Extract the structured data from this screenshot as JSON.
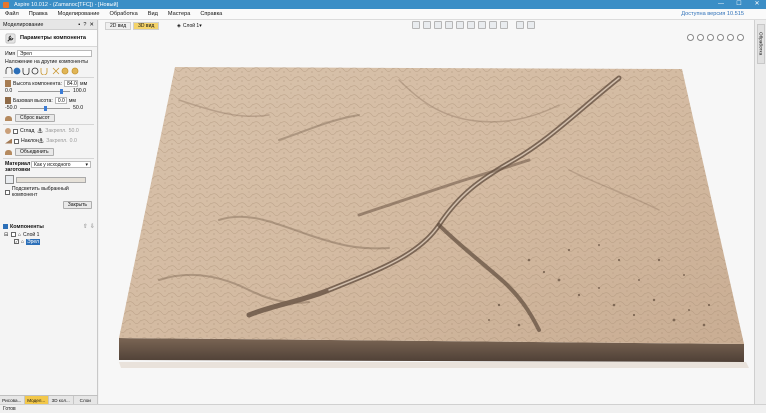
{
  "titlebar": {
    "title": "Aspire 10.012 - (Zamanoc[TFC]) - [Новый]",
    "min": "—",
    "max": "☐",
    "close": "✕"
  },
  "menu": {
    "items": [
      "Файл",
      "Правка",
      "Моделирование",
      "Обработка",
      "Вид",
      "Мастера",
      "Справка"
    ],
    "version_link": "Доступна версия 10.515"
  },
  "left_panel": {
    "header": "Моделирование",
    "params_title": "Параметры компонента",
    "name_label": "Имя",
    "name_value": "Эрел",
    "overlay_label": "Наложение на другие компоненты",
    "height_label": "Высота компонента:",
    "height_value": "84.0",
    "height_unit": "мм",
    "height_min": "0.0",
    "height_max": "100.0",
    "height_fraction": 0.84,
    "base_label": "Базовая высота:",
    "base_value": "0.0",
    "base_unit": "мм",
    "base_min": "-50.0",
    "base_max": "50.0",
    "base_fraction": 0.5,
    "reset_height": "Сброс высот",
    "smooth_label": "Сглад",
    "fix_label": "Закрепл.",
    "smooth_value": "50.0",
    "tilt_label": "Наклон",
    "tilt_value": "0.0",
    "combine_button": "Объединить",
    "material_label": "Материал заготовки",
    "material_select": "Как у исходного",
    "highlight_label": "Подсветить выбранный компонент",
    "close_button": "Закрыть"
  },
  "components": {
    "title": "Компоненты",
    "layer": "Слой 1",
    "item": "Эрел"
  },
  "bottom_tabs": [
    "Рисова...",
    "Модел...",
    "3D кол...",
    "Слои"
  ],
  "status": "Готов",
  "view": {
    "tabs": [
      "2D вид",
      "3D вид"
    ],
    "layer_select": "Слой 1"
  },
  "right_strip": {
    "tab": "Обработка"
  },
  "colors": {
    "titlebar": "#3b8ec6",
    "accent": "#f4d36a",
    "terrain_top": "#d4bba2",
    "terrain_side": "#6b5848"
  }
}
